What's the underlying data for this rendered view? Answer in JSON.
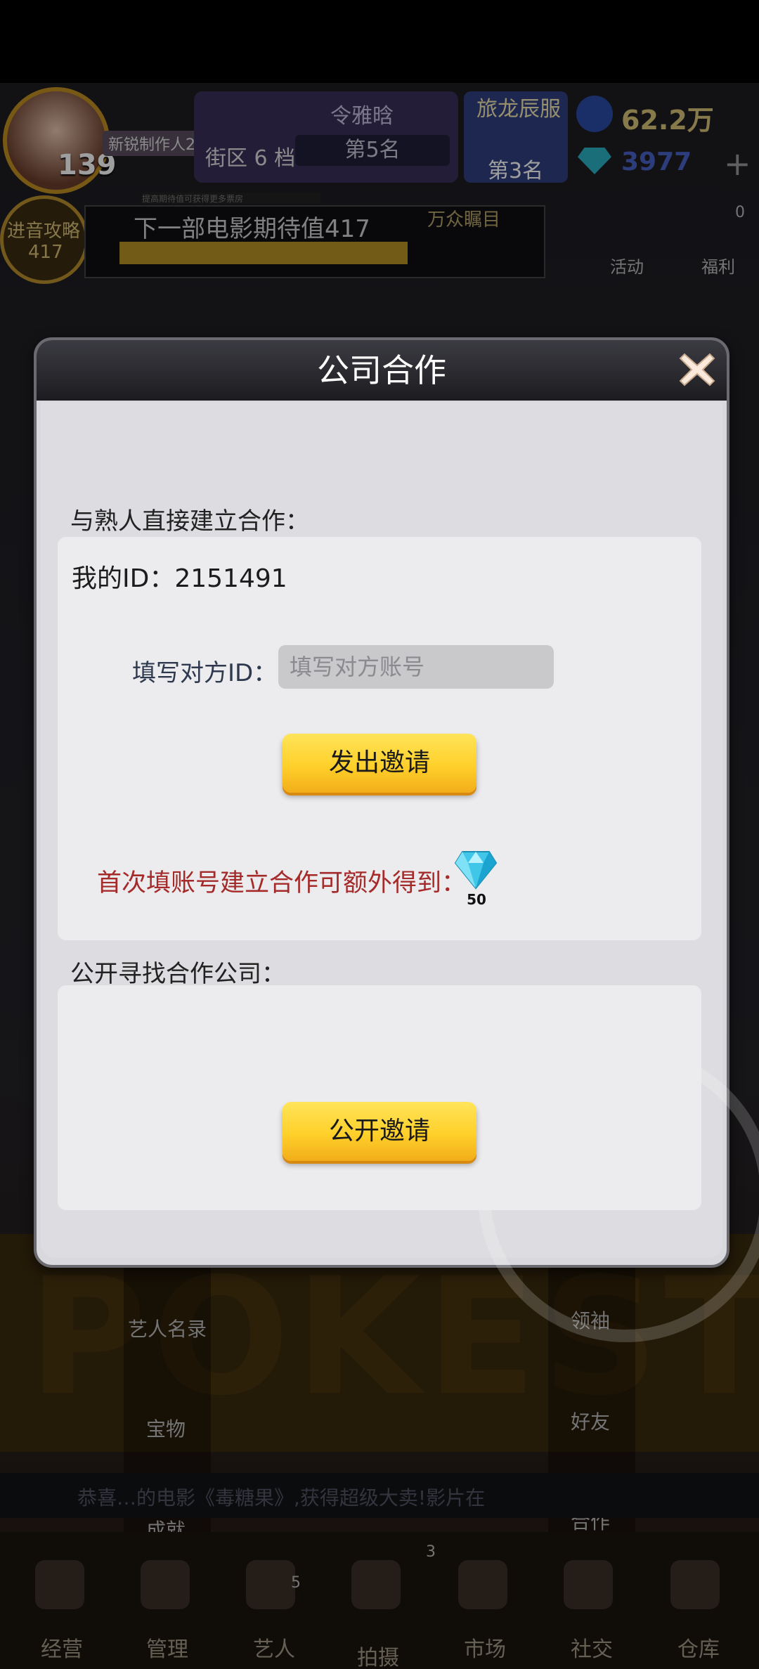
{
  "hud": {
    "level": "139",
    "rank_badge": "新锐制作人2",
    "league_name": "令雅晗",
    "league_rank": "第5名",
    "district": "街区 6 档",
    "server_name": "旅龙辰服",
    "server_rank": "第3名",
    "gold": "62.2万",
    "gems": "3977",
    "plus": "+",
    "guide_title": "进音攻略",
    "guide_num": "417",
    "movie_bar_title": "下一部电影期待值417",
    "movie_bar_target": "万众瞩目",
    "hint_strip": "提高期待值可获得更多票房",
    "activity": "活动",
    "welfare": "福利",
    "welfare_badge": "0"
  },
  "side_menu_left": [
    "艺人名录",
    "宝物",
    "成就"
  ],
  "side_menu_right": [
    "领袖",
    "好友",
    "合作"
  ],
  "banner_text": "POKESTAR",
  "ticker": "恭喜…的电影《毒糖果》,获得超级大卖!影片在",
  "bottom_nav": [
    {
      "label": "经营",
      "badge": ""
    },
    {
      "label": "管理",
      "badge": ""
    },
    {
      "label": "艺人",
      "badge": "5"
    },
    {
      "label": "拍摄",
      "badge": "3"
    },
    {
      "label": "市场",
      "badge": ""
    },
    {
      "label": "社交",
      "badge": ""
    },
    {
      "label": "仓库",
      "badge": ""
    }
  ],
  "dialog": {
    "title": "公司合作",
    "direct_section_label": "与熟人直接建立合作：",
    "my_id_label": "我的ID：2151491",
    "fill_id_label": "填写对方ID：",
    "fill_id_placeholder": "填写对方账号",
    "fill_id_value": "",
    "send_invite_button": "发出邀请",
    "reward_text": "首次填账号建立合作可额外得到：",
    "reward_icon": "diamond-icon",
    "reward_amount": "50",
    "public_section_label": "公开寻找合作公司：",
    "public_invite_button": "公开邀请"
  },
  "colors": {
    "button_yellow": "#ffd02a",
    "reward_red": "#a52a2a",
    "dialog_bg": "#dddde1",
    "header_dark": "#1c1c20"
  }
}
